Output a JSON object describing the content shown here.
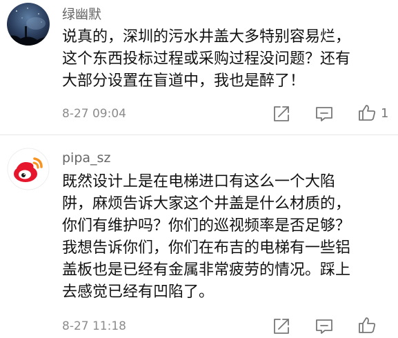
{
  "comments": [
    {
      "username": "绿幽默",
      "avatar_icon": "night-sky-avatar-icon",
      "text_lines": [
        "说真的，深圳的污水井盖大多特别容易烂，",
        "这个东西投标过程或采购过程没问题？还有",
        "大部分设置在盲道中，我也是醉了！"
      ],
      "timestamp": "8-27 09:04",
      "like_count": "1"
    },
    {
      "username": "pipa_sz",
      "avatar_icon": "weibo-logo-avatar-icon",
      "text_lines": [
        "既然设计上是在电梯进口有这么一个大陷",
        "阱，麻烦告诉大家这个井盖是什么材质的，",
        "你们有维护吗？你们的巡视频率是否足够？",
        "我想告诉你们，你们在布吉的电梯有一些铝",
        "盖板也是已经有金属非常疲劳的情况。踩上",
        "去感觉已经有凹陷了。"
      ],
      "timestamp": "8-27 11:18",
      "like_count": ""
    }
  ],
  "colors": {
    "text": "#111111",
    "username": "#666666",
    "meta": "#8c8c8c",
    "icon": "#777777",
    "weibo_red": "#e6162d",
    "weibo_orange": "#f7931e"
  },
  "icons": {
    "share": "share-icon",
    "comment": "comment-icon",
    "like": "thumbs-up-icon"
  }
}
